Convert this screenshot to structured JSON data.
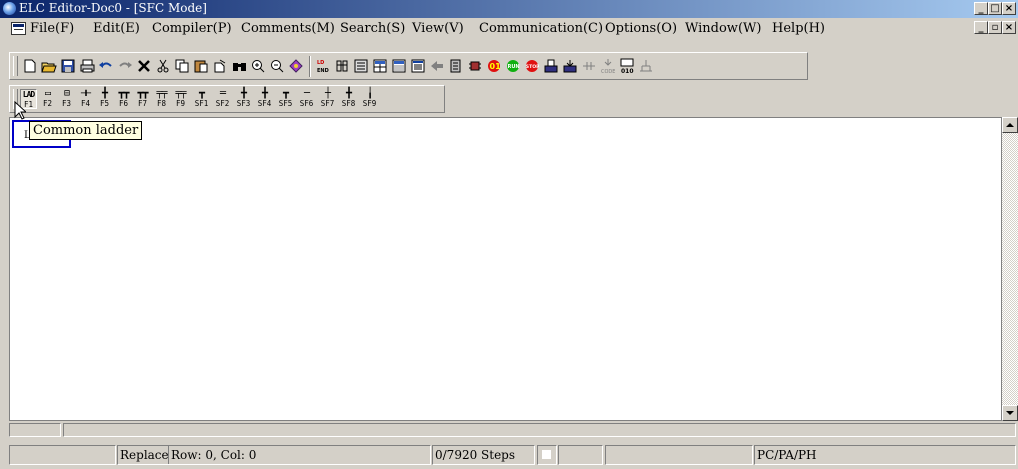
{
  "window": {
    "title": "ELC Editor-Doc0 - [SFC Mode]",
    "controls": [
      "_",
      "□",
      "×"
    ],
    "mdi_controls": [
      "_",
      "▫",
      "×"
    ]
  },
  "menu": [
    "File(F)",
    "Edit(E)",
    "Compiler(P)",
    "Comments(M)",
    "Search(S)",
    "View(V)",
    "Communication(C)",
    "Options(O)",
    "Window(W)",
    "Help(H)"
  ],
  "sfc_toolbar": {
    "keys": [
      {
        "top": "LAD",
        "bottom": "F1"
      },
      {
        "top": "▭",
        "bottom": "F2"
      },
      {
        "top": "⊟",
        "bottom": "F3"
      },
      {
        "top": "⊣⊢",
        "bottom": "F4"
      },
      {
        "top": "╋",
        "bottom": "F5"
      },
      {
        "top": "┳┳",
        "bottom": "F6"
      },
      {
        "top": "┳┳",
        "bottom": "F7"
      },
      {
        "top": "╤╤",
        "bottom": "F8"
      },
      {
        "top": "╤╤",
        "bottom": "F9"
      },
      {
        "top": "┳",
        "bottom": "SF1"
      },
      {
        "top": "═",
        "bottom": "SF2"
      },
      {
        "top": "╋",
        "bottom": "SF3"
      },
      {
        "top": "╋",
        "bottom": "SF4"
      },
      {
        "top": "┳",
        "bottom": "SF5"
      },
      {
        "top": "─",
        "bottom": "SF6"
      },
      {
        "top": "┼",
        "bottom": "SF7"
      },
      {
        "top": "╋",
        "bottom": "SF8"
      },
      {
        "top": "╽",
        "bottom": "SF9"
      }
    ]
  },
  "editor": {
    "cell_label": "LAD",
    "tooltip": "Common ladder"
  },
  "status": {
    "mode": "Replace",
    "position": "Row: 0, Col: 0",
    "steps": "0/7920 Steps",
    "plc": "PC/PA/PH"
  }
}
